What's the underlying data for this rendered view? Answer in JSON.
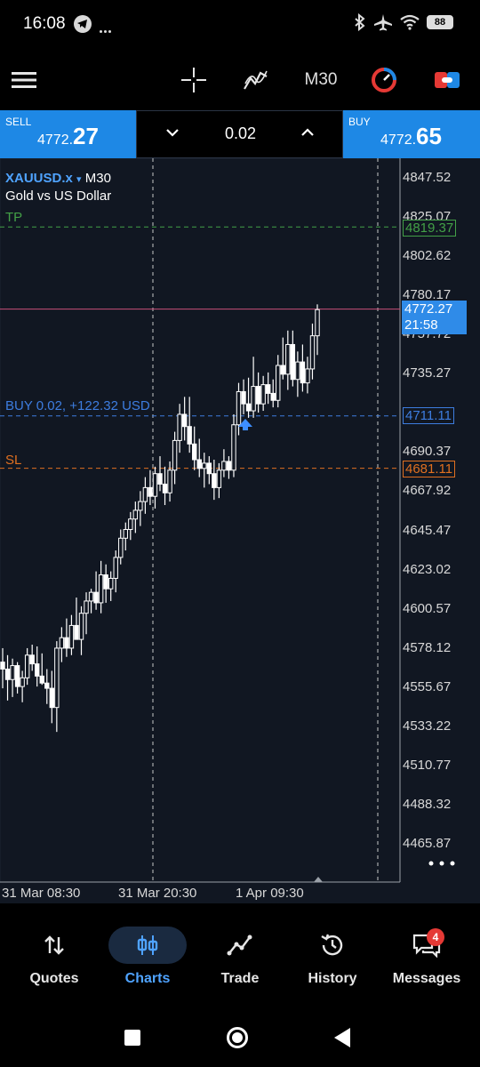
{
  "status_bar": {
    "time": "16:08",
    "battery": "88"
  },
  "toolbar": {
    "timeframe": "M30"
  },
  "trade": {
    "sell_label": "SELL",
    "sell_price_prefix": "4772.",
    "sell_price_big": "27",
    "volume": "0.02",
    "buy_label": "BUY",
    "buy_price_prefix": "4772.",
    "buy_price_big": "65"
  },
  "chart": {
    "symbol": "XAUUSD.x",
    "symbol_dropdown": "▾",
    "timeframe": "M30",
    "description": "Gold vs US Dollar",
    "tp_label": "TP",
    "sl_label": "SL",
    "position_label": "BUY 0.02,  +122.32 USD",
    "tp_tag": "4819.37",
    "sl_tag": "4681.11",
    "entry_tag": "4711.11",
    "price_tag": "4772.27",
    "countdown": "21:58",
    "price_axis": [
      "4847.52",
      "4825.07",
      "4802.62",
      "4780.17",
      "4757.72",
      "4735.27",
      "4690.37",
      "4667.92",
      "4645.47",
      "4623.02",
      "4600.57",
      "4578.12",
      "4555.67",
      "4533.22",
      "4510.77",
      "4488.32",
      "4465.87"
    ],
    "time_axis": [
      "31 Mar 08:30",
      "31 Mar 20:30",
      "1 Apr 09:30"
    ],
    "colors": {
      "tp": "#43a047",
      "sl": "#e07020",
      "entry": "#3d7de0",
      "price_line": "#c84f7a",
      "background": "#111722"
    }
  },
  "chart_data": {
    "type": "candlestick",
    "symbol": "XAUUSD.x",
    "timeframe": "M30",
    "ylim": [
      4455,
      4860
    ],
    "levels": {
      "tp": 4819.37,
      "sl": 4681.11,
      "entry": 4711.11,
      "last": 4772.27
    },
    "candles": [
      {
        "o": 4570,
        "h": 4578,
        "l": 4555,
        "c": 4566
      },
      {
        "o": 4566,
        "h": 4574,
        "l": 4548,
        "c": 4560
      },
      {
        "o": 4560,
        "h": 4572,
        "l": 4550,
        "c": 4568
      },
      {
        "o": 4568,
        "h": 4570,
        "l": 4552,
        "c": 4556
      },
      {
        "o": 4556,
        "h": 4565,
        "l": 4547,
        "c": 4561
      },
      {
        "o": 4561,
        "h": 4578,
        "l": 4557,
        "c": 4574
      },
      {
        "o": 4574,
        "h": 4580,
        "l": 4565,
        "c": 4569
      },
      {
        "o": 4569,
        "h": 4579,
        "l": 4556,
        "c": 4562
      },
      {
        "o": 4562,
        "h": 4575,
        "l": 4557,
        "c": 4558
      },
      {
        "o": 4558,
        "h": 4566,
        "l": 4546,
        "c": 4555
      },
      {
        "o": 4555,
        "h": 4565,
        "l": 4535,
        "c": 4544
      },
      {
        "o": 4544,
        "h": 4582,
        "l": 4530,
        "c": 4578
      },
      {
        "o": 4578,
        "h": 4590,
        "l": 4570,
        "c": 4584
      },
      {
        "o": 4584,
        "h": 4595,
        "l": 4573,
        "c": 4578
      },
      {
        "o": 4578,
        "h": 4597,
        "l": 4574,
        "c": 4591
      },
      {
        "o": 4591,
        "h": 4607,
        "l": 4585,
        "c": 4583
      },
      {
        "o": 4583,
        "h": 4602,
        "l": 4574,
        "c": 4598
      },
      {
        "o": 4598,
        "h": 4610,
        "l": 4586,
        "c": 4605
      },
      {
        "o": 4605,
        "h": 4612,
        "l": 4598,
        "c": 4610
      },
      {
        "o": 4610,
        "h": 4622,
        "l": 4600,
        "c": 4604
      },
      {
        "o": 4604,
        "h": 4628,
        "l": 4598,
        "c": 4620
      },
      {
        "o": 4620,
        "h": 4626,
        "l": 4604,
        "c": 4612
      },
      {
        "o": 4612,
        "h": 4622,
        "l": 4605,
        "c": 4618
      },
      {
        "o": 4618,
        "h": 4634,
        "l": 4610,
        "c": 4630
      },
      {
        "o": 4630,
        "h": 4646,
        "l": 4626,
        "c": 4641
      },
      {
        "o": 4641,
        "h": 4650,
        "l": 4634,
        "c": 4646
      },
      {
        "o": 4646,
        "h": 4656,
        "l": 4640,
        "c": 4652
      },
      {
        "o": 4652,
        "h": 4662,
        "l": 4644,
        "c": 4657
      },
      {
        "o": 4657,
        "h": 4668,
        "l": 4648,
        "c": 4662
      },
      {
        "o": 4662,
        "h": 4676,
        "l": 4655,
        "c": 4670
      },
      {
        "o": 4670,
        "h": 4680,
        "l": 4660,
        "c": 4665
      },
      {
        "o": 4665,
        "h": 4682,
        "l": 4658,
        "c": 4678
      },
      {
        "o": 4678,
        "h": 4688,
        "l": 4668,
        "c": 4672
      },
      {
        "o": 4672,
        "h": 4682,
        "l": 4660,
        "c": 4667
      },
      {
        "o": 4667,
        "h": 4685,
        "l": 4662,
        "c": 4680
      },
      {
        "o": 4680,
        "h": 4702,
        "l": 4672,
        "c": 4697
      },
      {
        "o": 4697,
        "h": 4718,
        "l": 4690,
        "c": 4712
      },
      {
        "o": 4712,
        "h": 4722,
        "l": 4697,
        "c": 4705
      },
      {
        "o": 4705,
        "h": 4722,
        "l": 4690,
        "c": 4695
      },
      {
        "o": 4695,
        "h": 4705,
        "l": 4680,
        "c": 4686
      },
      {
        "o": 4686,
        "h": 4698,
        "l": 4676,
        "c": 4681
      },
      {
        "o": 4681,
        "h": 4690,
        "l": 4670,
        "c": 4684
      },
      {
        "o": 4684,
        "h": 4688,
        "l": 4672,
        "c": 4678
      },
      {
        "o": 4678,
        "h": 4686,
        "l": 4663,
        "c": 4670
      },
      {
        "o": 4670,
        "h": 4684,
        "l": 4664,
        "c": 4680
      },
      {
        "o": 4680,
        "h": 4692,
        "l": 4676,
        "c": 4685
      },
      {
        "o": 4685,
        "h": 4688,
        "l": 4675,
        "c": 4680
      },
      {
        "o": 4680,
        "h": 4712,
        "l": 4676,
        "c": 4706
      },
      {
        "o": 4706,
        "h": 4730,
        "l": 4700,
        "c": 4725
      },
      {
        "o": 4725,
        "h": 4732,
        "l": 4712,
        "c": 4718
      },
      {
        "o": 4718,
        "h": 4733,
        "l": 4710,
        "c": 4714
      },
      {
        "o": 4714,
        "h": 4745,
        "l": 4710,
        "c": 4728
      },
      {
        "o": 4728,
        "h": 4736,
        "l": 4713,
        "c": 4718
      },
      {
        "o": 4718,
        "h": 4734,
        "l": 4714,
        "c": 4729
      },
      {
        "o": 4729,
        "h": 4736,
        "l": 4718,
        "c": 4724
      },
      {
        "o": 4724,
        "h": 4732,
        "l": 4716,
        "c": 4720
      },
      {
        "o": 4720,
        "h": 4746,
        "l": 4716,
        "c": 4740
      },
      {
        "o": 4740,
        "h": 4756,
        "l": 4732,
        "c": 4735
      },
      {
        "o": 4735,
        "h": 4760,
        "l": 4726,
        "c": 4752
      },
      {
        "o": 4752,
        "h": 4760,
        "l": 4728,
        "c": 4732
      },
      {
        "o": 4732,
        "h": 4748,
        "l": 4722,
        "c": 4742
      },
      {
        "o": 4742,
        "h": 4752,
        "l": 4725,
        "c": 4730
      },
      {
        "o": 4730,
        "h": 4745,
        "l": 4724,
        "c": 4738
      },
      {
        "o": 4738,
        "h": 4764,
        "l": 4732,
        "c": 4757
      },
      {
        "o": 4757,
        "h": 4775,
        "l": 4746,
        "c": 4772
      }
    ]
  },
  "nav": [
    {
      "label": "Quotes",
      "icon": "quotes-icon"
    },
    {
      "label": "Charts",
      "icon": "charts-icon"
    },
    {
      "label": "Trade",
      "icon": "trade-icon"
    },
    {
      "label": "History",
      "icon": "history-icon"
    },
    {
      "label": "Messages",
      "icon": "messages-icon",
      "badge": "4"
    }
  ]
}
